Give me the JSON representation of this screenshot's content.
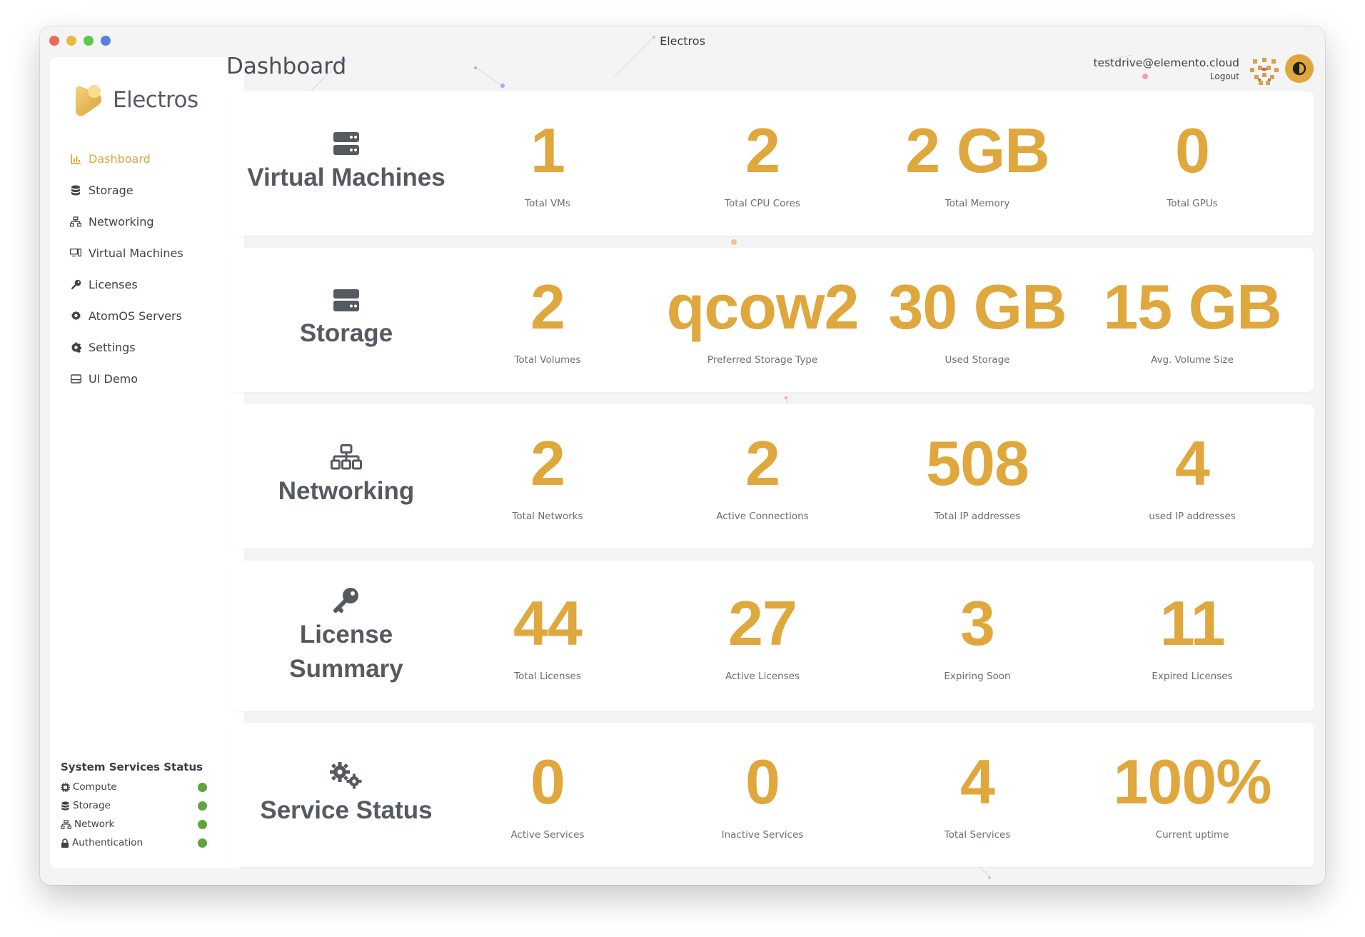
{
  "window": {
    "title": "Electros"
  },
  "brand": {
    "name": "Electros"
  },
  "colors": {
    "accent": "#dfa73c",
    "status_ok": "#5ea53f",
    "text": "#555960"
  },
  "sidebar": {
    "items": [
      {
        "label": "Dashboard",
        "icon": "chart-icon",
        "active": true
      },
      {
        "label": "Storage",
        "icon": "database-icon"
      },
      {
        "label": "Networking",
        "icon": "network-icon"
      },
      {
        "label": "Virtual Machines",
        "icon": "desktop-icon"
      },
      {
        "label": "Licenses",
        "icon": "key-icon"
      },
      {
        "label": "AtomOS Servers",
        "icon": "cog-icon"
      },
      {
        "label": "Settings",
        "icon": "gear-icon"
      },
      {
        "label": "UI Demo",
        "icon": "drive-icon"
      }
    ],
    "status": {
      "title": "System Services Status",
      "items": [
        {
          "label": "Compute",
          "icon": "chip-icon",
          "state": "ok"
        },
        {
          "label": "Storage",
          "icon": "database-icon",
          "state": "ok"
        },
        {
          "label": "Network",
          "icon": "network-icon",
          "state": "ok"
        },
        {
          "label": "Authentication",
          "icon": "lock-icon",
          "state": "ok"
        }
      ]
    }
  },
  "header": {
    "title": "Dashboard",
    "user_email": "testdrive@elemento.cloud",
    "logout_label": "Logout"
  },
  "cards": [
    {
      "title": "Virtual Machines",
      "icon": "server-icon",
      "stats": [
        {
          "value": "1",
          "label": "Total VMs"
        },
        {
          "value": "2",
          "label": "Total CPU Cores"
        },
        {
          "value": "2 GB",
          "label": "Total Memory"
        },
        {
          "value": "0",
          "label": "Total GPUs"
        }
      ]
    },
    {
      "title": "Storage",
      "icon": "drive-icon",
      "stats": [
        {
          "value": "2",
          "label": "Total Volumes"
        },
        {
          "value": "qcow2",
          "label": "Preferred Storage Type"
        },
        {
          "value": "30 GB",
          "label": "Used Storage"
        },
        {
          "value": "15 GB",
          "label": "Avg. Volume Size"
        }
      ]
    },
    {
      "title": "Networking",
      "icon": "network-icon",
      "stats": [
        {
          "value": "2",
          "label": "Total Networks"
        },
        {
          "value": "2",
          "label": "Active Connections"
        },
        {
          "value": "508",
          "label": "Total IP addresses"
        },
        {
          "value": "4",
          "label": "used IP addresses"
        }
      ]
    },
    {
      "title_lines": [
        "License",
        "Summary"
      ],
      "icon": "key-icon",
      "stats": [
        {
          "value": "44",
          "label": "Total Licenses"
        },
        {
          "value": "27",
          "label": "Active Licenses"
        },
        {
          "value": "3",
          "label": "Expiring Soon"
        },
        {
          "value": "11",
          "label": "Expired Licenses"
        }
      ]
    },
    {
      "title": "Service Status",
      "icon": "cogs-icon",
      "stats": [
        {
          "value": "0",
          "label": "Active Services"
        },
        {
          "value": "0",
          "label": "Inactive Services"
        },
        {
          "value": "4",
          "label": "Total Services"
        },
        {
          "value": "100%",
          "label": "Current uptime"
        }
      ]
    }
  ]
}
